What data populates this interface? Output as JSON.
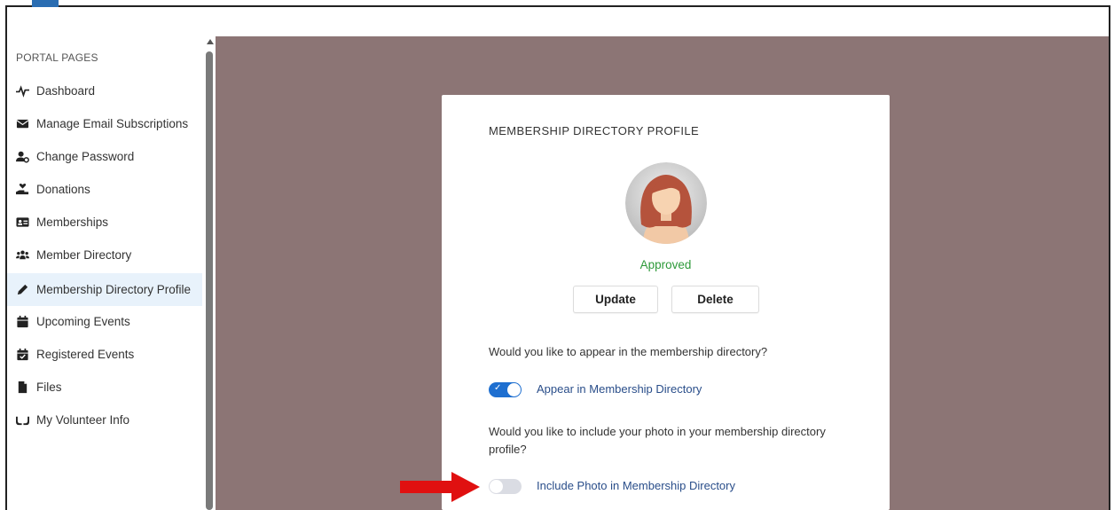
{
  "sidebar": {
    "heading": "PORTAL PAGES",
    "items": [
      {
        "label": "Dashboard",
        "icon": "pulse-icon"
      },
      {
        "label": "Manage Email Subscriptions",
        "icon": "envelope-icon"
      },
      {
        "label": "Change Password",
        "icon": "user-cog-icon"
      },
      {
        "label": "Donations",
        "icon": "hand-holding-heart-icon"
      },
      {
        "label": "Memberships",
        "icon": "id-card-icon"
      },
      {
        "label": "Member Directory",
        "icon": "users-icon"
      },
      {
        "label": "Membership Directory Profile",
        "icon": "pencil-icon",
        "active": true
      },
      {
        "label": "Upcoming Events",
        "icon": "calendar-icon"
      },
      {
        "label": "Registered Events",
        "icon": "calendar-check-icon"
      },
      {
        "label": "Files",
        "icon": "file-icon"
      },
      {
        "label": "My Volunteer Info",
        "icon": "hands-icon"
      }
    ]
  },
  "card": {
    "title": "MEMBERSHIP DIRECTORY PROFILE",
    "status": "Approved",
    "update_label": "Update",
    "delete_label": "Delete",
    "question1": "Would you like to appear in the membership directory?",
    "toggle1_label": "Appear in Membership Directory",
    "toggle1_on": true,
    "question2": "Would you like to include your photo in your membership directory profile?",
    "toggle2_label": "Include Photo in Membership Directory",
    "toggle2_on": false
  },
  "colors": {
    "main_background": "#8c7575",
    "accent": "#1e6fd0",
    "approved": "#2e9a3a",
    "arrow": "#e01010"
  }
}
